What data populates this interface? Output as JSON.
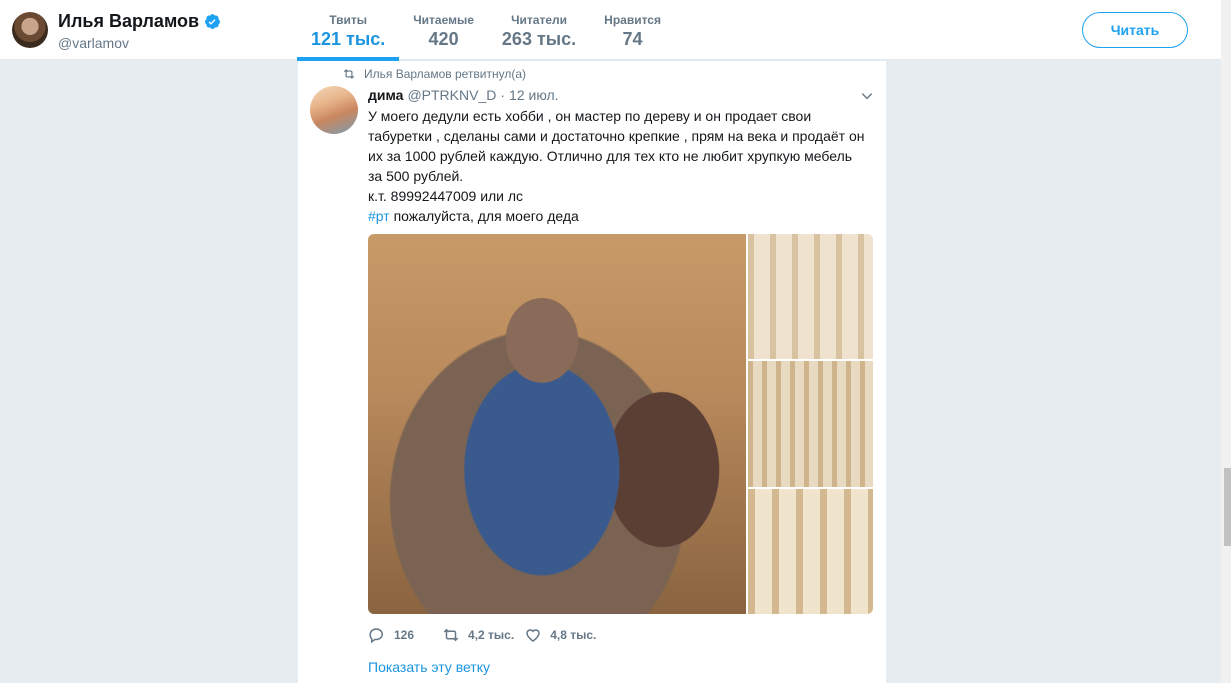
{
  "profile": {
    "name": "Илья Варламов",
    "handle": "@varlamov"
  },
  "stats": [
    {
      "label": "Твиты",
      "value": "121 тыс.",
      "active": true
    },
    {
      "label": "Читаемые",
      "value": "420"
    },
    {
      "label": "Читатели",
      "value": "263 тыс."
    },
    {
      "label": "Нравится",
      "value": "74"
    }
  ],
  "follow_label": "Читать",
  "tweet": {
    "retweet_context": "Илья Варламов ретвитнул(а)",
    "author_name": "дима",
    "author_handle": "@PTRKNV_D",
    "separator": "·",
    "date": "12 июл.",
    "text": "У моего дедули есть хобби , он мастер по дереву и он продает свои табуретки , сделаны сами и достаточно крепкие , прям на века и продаёт он их за 1000 рублей каждую. Отлично для тех кто не любит хрупкую мебель за 500 рублей.\nк.т. 89992447009 или лс\n",
    "hashtag": "#рт",
    "text_tail": " пожалуйста, для моего деда",
    "replies": "126",
    "retweets": "4,2 тыс.",
    "likes": "4,8 тыс.",
    "show_thread": "Показать эту ветку"
  },
  "icons": {
    "verified": "verified-badge-icon",
    "retweet": "retweet-icon",
    "caret": "chevron-down-icon",
    "reply": "reply-icon",
    "like": "heart-icon"
  },
  "colors": {
    "accent": "#1da1f2",
    "link": "#1b95e0",
    "muted": "#657786",
    "background": "#e6ecf0"
  }
}
